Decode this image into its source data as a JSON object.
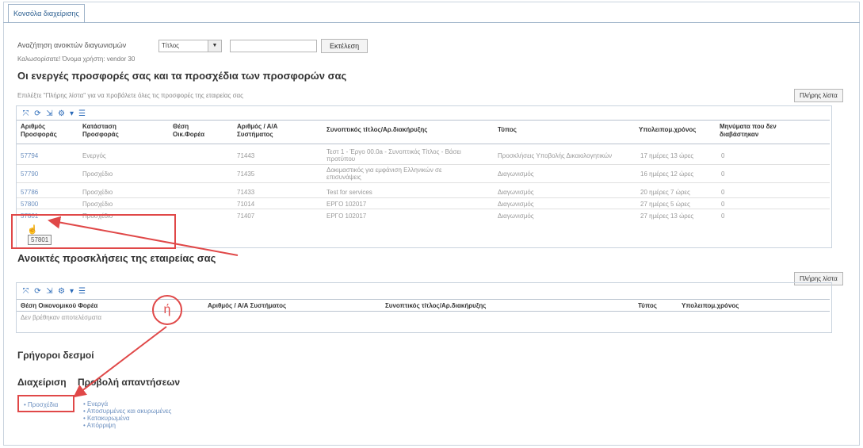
{
  "tab": {
    "label": "Κονσόλα διαχείρισης"
  },
  "search": {
    "label": "Αναζήτηση ανοικτών διαγωνισμών",
    "select_value": "Τίτλος",
    "go_label": "Εκτέλεση"
  },
  "welcome": "Καλωσορίσατε! Όνομα χρήστη: vendor 30",
  "section1": {
    "title": "Οι ενεργές προσφορές σας και τα προσχέδια των προσφορών σας",
    "hint": "Επιλέξτε \"Πλήρης λίστα\" για να προβάλετε όλες τις προσφορές της εταιρείας σας",
    "full_list_label": "Πλήρης λίστα",
    "headers": [
      "Αριθμός Προσφοράς",
      "Κατάσταση Προσφοράς",
      "Θέση Οικ.Φορέα",
      "Αριθμός / Α/Α Συστήματος",
      "Συνοπτικός τίτλος/Αρ.διακήρυξης",
      "Τύπος",
      "Υπολειπομ.χρόνος",
      "Μηνύματα που δεν διαβάστηκαν"
    ],
    "rows": [
      [
        "57794",
        "Ενεργός",
        "",
        "71443",
        "Τεστ 1 - Έργο 00.0a - Συνοπτικός Τίτλος - Βάσει προτύπου",
        "Προσκλήσεις Υποβολής Δικαιολογητικών",
        "17 ημέρες 13 ώρες",
        "0"
      ],
      [
        "57790",
        "Προσχέδιο",
        "",
        "71435",
        "Δοκιμαστικός για εμφάνιση Ελληνικών σε επισυνάψεις",
        "Διαγωνισμός",
        "16 ημέρες 12 ώρες",
        "0"
      ],
      [
        "57786",
        "Προσχέδιο",
        "",
        "71433",
        "Test for services",
        "Διαγωνισμός",
        "20 ημέρες 7 ώρες",
        "0"
      ],
      [
        "57800",
        "Προσχέδιο",
        "",
        "71014",
        "ΕΡΓΟ 102017",
        "Διαγωνισμός",
        "27 ημέρες 5 ώρες",
        "0"
      ],
      [
        "57801",
        "Προσχέδιο",
        "",
        "71407",
        "ΕΡΓΟ 102017",
        "Διαγωνισμός",
        "27 ημέρες 13 ώρες",
        "0"
      ]
    ],
    "tooltip": "57801"
  },
  "section2": {
    "title": "Ανοικτές προσκλήσεις της εταιρείας σας",
    "full_list_label": "Πλήρης λίστα",
    "headers": [
      "Θέση Οικονομικού Φορέα",
      "Αριθμός / Α/Α Συστήματος",
      "Συνοπτικός τίτλος/Αρ.διακήρυξης",
      "Τύπος",
      "Υπολειπομ.χρόνος"
    ],
    "empty_text": "Δεν βρέθηκαν αποτελέσματα",
    "circle_label": "ή"
  },
  "quick_links": {
    "title": "Γρήγοροι δεσμοί",
    "manage_label": "Διαχείριση",
    "view_label": "Προβολή απαντήσεων",
    "drafts_label": "Προσχέδια",
    "responses": [
      "Ενεργά",
      "Αποσυρμένες και ακυρωμένες",
      "Κατακυρωμένα",
      "Απόρριψη"
    ]
  },
  "colors": {
    "annotation": "#e04848",
    "link": "#2a5d8f"
  }
}
